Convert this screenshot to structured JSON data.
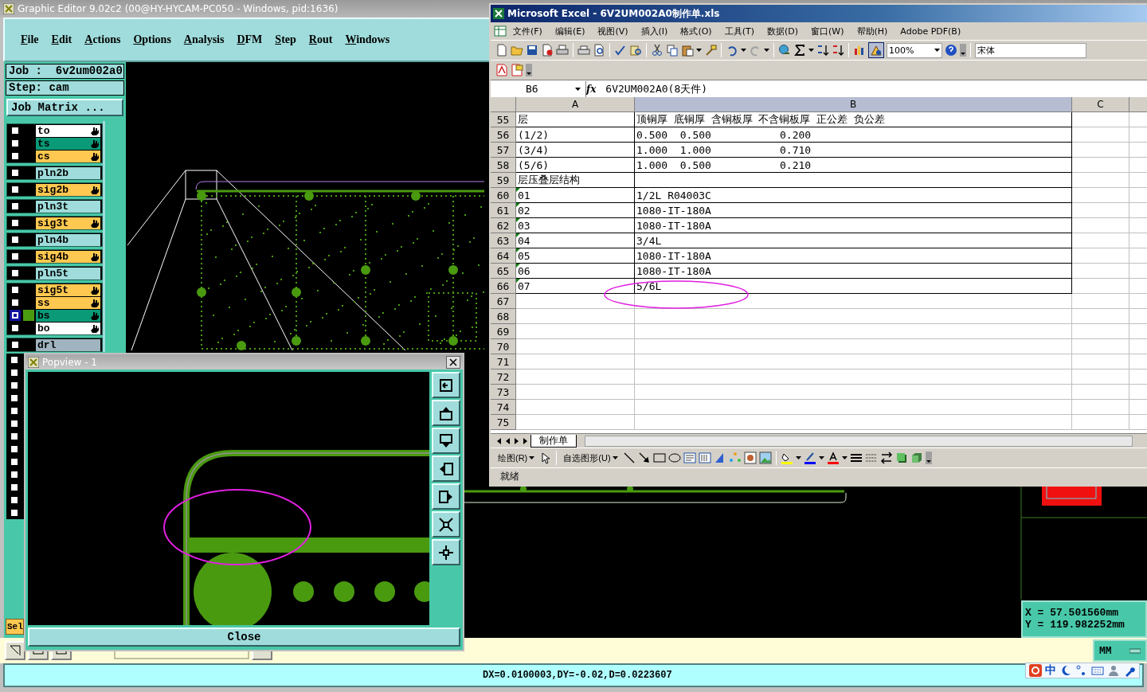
{
  "editor": {
    "title": "Graphic Editor 9.02c2 (00@HY-HYCAM-PC050 - Windows, pid:1636)",
    "menu": [
      "File",
      "Edit",
      "Actions",
      "Options",
      "Analysis",
      "DFM",
      "Step",
      "Rout",
      "Windows"
    ],
    "job_line": "Job :  6v2um002a0",
    "step_line": "Step: cam",
    "job_matrix_button": "Job Matrix ...",
    "layer_groups": [
      {
        "layers": [
          {
            "name": "to",
            "color": "#ffffff",
            "selected": false,
            "marked": true
          },
          {
            "name": "ts",
            "color": "#0a9a78",
            "selected": false,
            "marked": true
          },
          {
            "name": "cs",
            "color": "#ffc850",
            "selected": false,
            "marked": true
          }
        ]
      },
      {
        "layers": [
          {
            "name": "pln2b",
            "color": "#a0dcdc",
            "selected": false,
            "marked": false
          }
        ]
      },
      {
        "layers": [
          {
            "name": "sig2b",
            "color": "#ffc850",
            "selected": false,
            "marked": true
          }
        ]
      },
      {
        "layers": [
          {
            "name": "pln3t",
            "color": "#a0dcdc",
            "selected": false,
            "marked": false
          }
        ]
      },
      {
        "layers": [
          {
            "name": "sig3t",
            "color": "#ffc850",
            "selected": false,
            "marked": true
          }
        ]
      },
      {
        "layers": [
          {
            "name": "pln4b",
            "color": "#a0dcdc",
            "selected": false,
            "marked": false
          }
        ]
      },
      {
        "layers": [
          {
            "name": "sig4b",
            "color": "#ffc850",
            "selected": false,
            "marked": true
          }
        ]
      },
      {
        "layers": [
          {
            "name": "pln5t",
            "color": "#a0dcdc",
            "selected": false,
            "marked": false
          }
        ]
      },
      {
        "layers": [
          {
            "name": "sig5t",
            "color": "#ffc850",
            "selected": false,
            "marked": true
          },
          {
            "name": "ss",
            "color": "#ffc850",
            "selected": false,
            "marked": true
          },
          {
            "name": "bs",
            "color": "#0a9a78",
            "selected": true,
            "marked": true
          },
          {
            "name": "bo",
            "color": "#ffffff",
            "selected": false,
            "marked": true
          }
        ]
      },
      {
        "layers": [
          {
            "name": "drl",
            "color": "#a0b4c0",
            "selected": false,
            "marked": false
          }
        ]
      }
    ],
    "hidden_layer_rows": [
      {
        "selected": false
      },
      {
        "selected": false
      },
      {
        "selected": false
      },
      {
        "selected": false
      },
      {
        "selected": false
      },
      {
        "selected": false
      },
      {
        "selected": false
      },
      {
        "selected": false
      },
      {
        "selected": false
      },
      {
        "selected": false
      },
      {
        "selected": false
      },
      {
        "selected": false
      },
      {
        "selected": false
      }
    ],
    "select_button": "Sel",
    "coordinates": [
      "X = 57.501560mm",
      "Y = 119.982252mm"
    ],
    "units_button": "MM",
    "status": "DX=0.0100003,DY=-0.02,D=0.0223607",
    "ime_label": "中"
  },
  "popview": {
    "title": "Popview - 1",
    "close_button": "Close"
  },
  "excel": {
    "title": "Microsoft Excel - 6V2UM002A0制作单.xls",
    "menu": [
      "文件(F)",
      "编辑(E)",
      "视图(V)",
      "插入(I)",
      "格式(O)",
      "工具(T)",
      "数据(D)",
      "窗口(W)",
      "帮助(H)",
      "Adobe PDF(B)"
    ],
    "zoom": "100%",
    "font": "宋体",
    "name_box": "B6",
    "function_label": "fx",
    "formula": "6V2UM002A0(8天件)",
    "columns": [
      "A",
      "B",
      "C"
    ],
    "rows": [
      {
        "number": "55",
        "a": "层",
        "b": "顶铜厚 底铜厚 含铜板厚 不含铜板厚 正公差 负公差",
        "flag": false
      },
      {
        "number": "56",
        "a": "(1/2)",
        "b": "0.500  0.500           0.200",
        "flag": false
      },
      {
        "number": "57",
        "a": "(3/4)",
        "b": "1.000  1.000           0.710",
        "flag": false
      },
      {
        "number": "58",
        "a": "(5/6)",
        "b": "1.000  0.500           0.210",
        "flag": false
      },
      {
        "number": "59",
        "a": "层压叠层结构",
        "flag": false
      },
      {
        "number": "60",
        "a": "01",
        "b": "1/2L R04003C",
        "flag": true
      },
      {
        "number": "61",
        "a": "02",
        "b": "1080-IT-180A",
        "flag": true
      },
      {
        "number": "62",
        "a": "03",
        "b": "1080-IT-180A",
        "flag": true
      },
      {
        "number": "63",
        "a": "04",
        "b": "3/4L",
        "flag": true
      },
      {
        "number": "64",
        "a": "05",
        "b": "1080-IT-180A",
        "flag": true
      },
      {
        "number": "65",
        "a": "06",
        "b": "1080-IT-180A",
        "flag": true
      },
      {
        "number": "66",
        "a": "07",
        "b": "5/6L",
        "flag": true
      },
      {
        "number": "67"
      },
      {
        "number": "68"
      },
      {
        "number": "69"
      },
      {
        "number": "70"
      },
      {
        "number": "71"
      },
      {
        "number": "72"
      },
      {
        "number": "73"
      },
      {
        "number": "74"
      },
      {
        "number": "75"
      }
    ],
    "sheet_tab": "制作单",
    "draw_menu": "绘图(R)",
    "autoshapes_menu": "自选图形(U)",
    "status": "就绪"
  }
}
